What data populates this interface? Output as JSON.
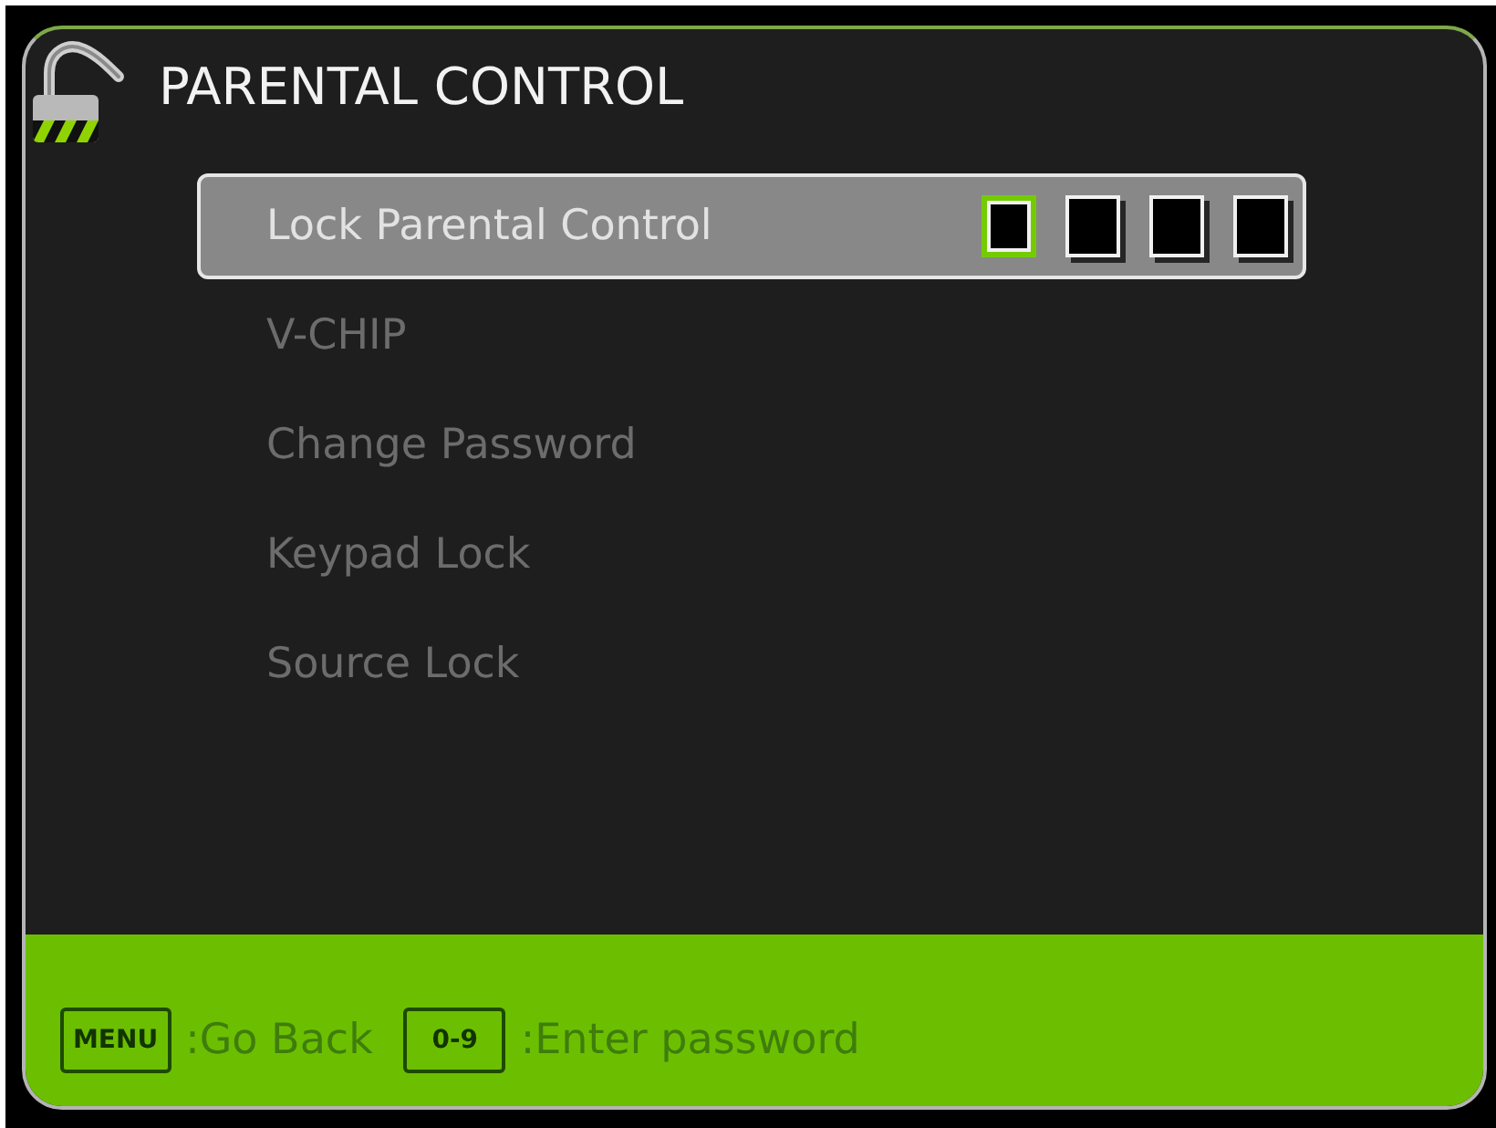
{
  "window": {
    "title": "PARENTAL CONTROL"
  },
  "menu": {
    "items": [
      {
        "label": "Lock Parental Control",
        "kind": "password",
        "selected": true,
        "disabled": false,
        "digits": [
          {
            "selected": true
          },
          {
            "selected": false
          },
          {
            "selected": false
          },
          {
            "selected": false
          }
        ]
      },
      {
        "label": "V-CHIP",
        "kind": "option",
        "selected": false,
        "disabled": true
      },
      {
        "label": "Change Password",
        "kind": "option",
        "selected": false,
        "disabled": true
      },
      {
        "label": "Keypad Lock",
        "kind": "option",
        "selected": false,
        "disabled": true
      },
      {
        "label": "Source Lock",
        "kind": "option",
        "selected": false,
        "disabled": true
      }
    ]
  },
  "footer": {
    "hints": [
      {
        "key": "MENU",
        "action": ":Go Back"
      },
      {
        "key": "0-9",
        "action": ":Enter password"
      }
    ]
  }
}
